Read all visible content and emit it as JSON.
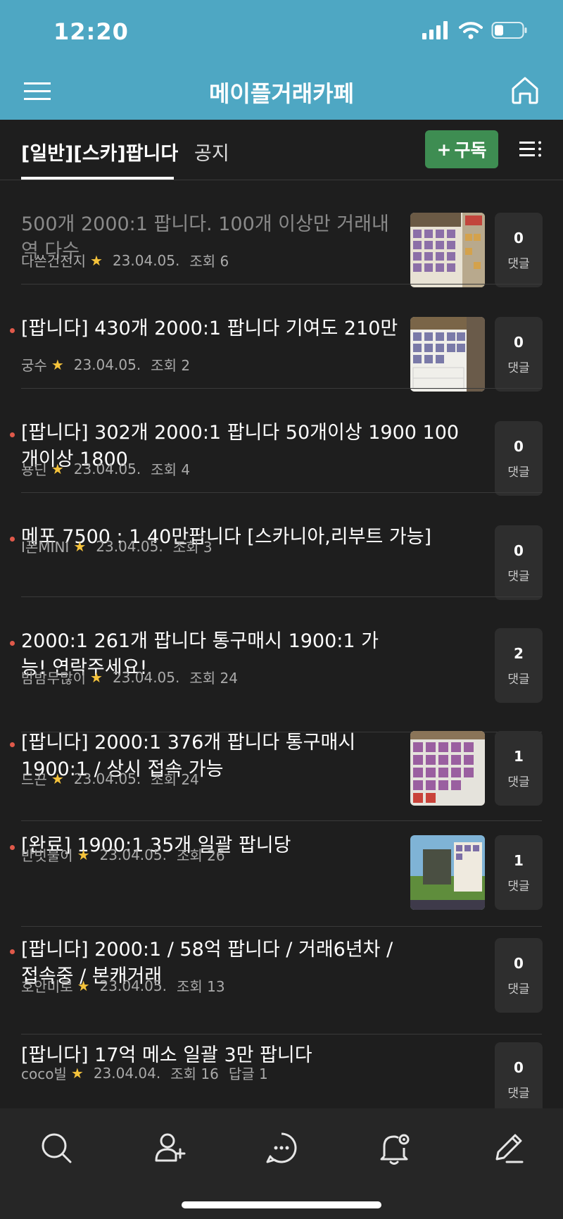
{
  "status": {
    "time": "12:20"
  },
  "header": {
    "title": "메이플거래카페"
  },
  "tabs": {
    "active": "[일반][스카]팝니다",
    "notice": "공지"
  },
  "subscribe": {
    "label": "구독",
    "plus": "+"
  },
  "colors": {
    "header_bg": "#4ea7c3",
    "subscribe_bg": "#3e8d52",
    "new_dot": "#e0594a",
    "star": "#f5c33b"
  },
  "comment_label": "댓글",
  "posts": [
    {
      "title": "500개 2000:1 팝니다. 100개 이상만 거래내역 다수",
      "author": "다쓴건전지",
      "date": "23.04.05.",
      "views": "조회 6",
      "comments": "0",
      "read": true
    },
    {
      "title": "[팝니다] 430개 2000:1 팝니다 기여도 210만",
      "author": "궁수",
      "date": "23.04.05.",
      "views": "조회 2",
      "comments": "0"
    },
    {
      "title": "[팝니다] 302개 2000:1 팝니다 50개이상 1900 100개이상 1800",
      "author": "뇽딘",
      "date": "23.04.05.",
      "views": "조회 4",
      "comments": "0"
    },
    {
      "title": "메포 7500 : 1 40만팝니다 [스카니아,리부트 가능]",
      "author": "I폰MINI",
      "date": "23.04.05.",
      "views": "조회 3",
      "comments": "0"
    },
    {
      "title": "2000:1 261개 팝니다 통구매시 1900:1 가능! 연락주세요!",
      "author": "밤밤무많이",
      "date": "23.04.05.",
      "views": "조회 24",
      "comments": "2"
    },
    {
      "title": "[팝니다] 2000:1 376개 팝니다 통구매시 1900:1 / 상시 접속 가능",
      "author": "드끈",
      "date": "23.04.05.",
      "views": "조회 24",
      "comments": "1"
    },
    {
      "title": "[완료] 1900:1 35개 일괄 팝니당",
      "author": "반빗불이",
      "date": "23.04.05.",
      "views": "조회 26",
      "comments": "1"
    },
    {
      "title": "[팝니다] 2000:1 / 58억 팝니다 / 거래6년차 / 접속중 / 본캐거래",
      "author": "호안미로",
      "date": "23.04.05.",
      "views": "조회 13",
      "comments": "0"
    },
    {
      "title": "[팝니다] 17억 메소 일괄 3만 팝니다",
      "author": "coco빌",
      "date": "23.04.04.",
      "views": "조회 16",
      "replies": "답글 1",
      "comments": "0"
    }
  ]
}
